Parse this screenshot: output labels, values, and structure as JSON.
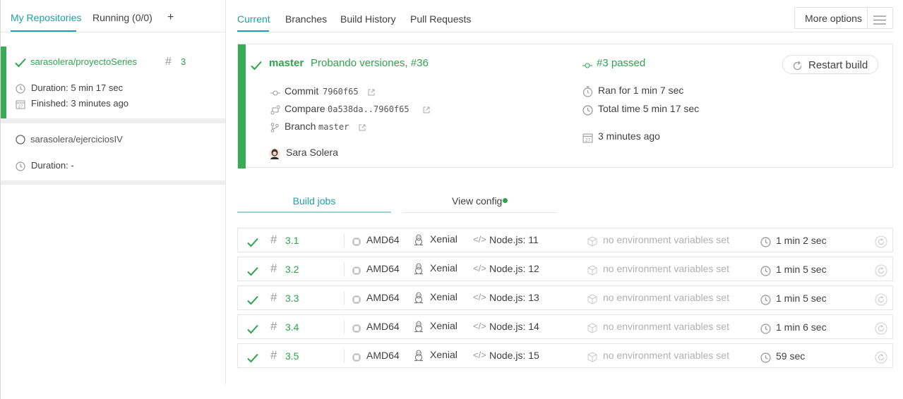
{
  "sidebar": {
    "tabs": {
      "my_repositories": "My Repositories",
      "running": "Running (0/0)",
      "add": "+"
    },
    "repos": [
      {
        "name": "sarasolera/proyectoSeries",
        "build_number": "3",
        "duration": "Duration: 5 min 17 sec",
        "finished": "Finished: 3 minutes ago",
        "status": "passed"
      },
      {
        "name": "sarasolera/ejerciciosIV",
        "duration": "Duration: -",
        "status": "none"
      }
    ]
  },
  "main_tabs": {
    "current": "Current",
    "branches": "Branches",
    "build_history": "Build History",
    "pull_requests": "Pull Requests"
  },
  "more_options": "More options",
  "build": {
    "branch": "master",
    "message": "Probando versiones, #36",
    "commit_label": "Commit",
    "commit": "7960f65",
    "compare_label": "Compare",
    "compare": "0a538da..7960f65",
    "branch_label": "Branch",
    "branch_value": "master",
    "author": "Sara Solera",
    "status": "#3 passed",
    "ran_for": "Ran for 1 min 7 sec",
    "total_time": "Total time 5 min 17 sec",
    "finished": "3 minutes ago",
    "restart_label": "Restart build",
    "calendar_day": "27"
  },
  "job_tabs": {
    "build_jobs": "Build jobs",
    "view_config": "View config"
  },
  "jobs": [
    {
      "number": "3.1",
      "arch": "AMD64",
      "os": "Xenial",
      "lang": "Node.js: 11",
      "env": "no environment variables set",
      "duration": "1 min 2 sec"
    },
    {
      "number": "3.2",
      "arch": "AMD64",
      "os": "Xenial",
      "lang": "Node.js: 12",
      "env": "no environment variables set",
      "duration": "1 min 5 sec"
    },
    {
      "number": "3.3",
      "arch": "AMD64",
      "os": "Xenial",
      "lang": "Node.js: 13",
      "env": "no environment variables set",
      "duration": "1 min 5 sec"
    },
    {
      "number": "3.4",
      "arch": "AMD64",
      "os": "Xenial",
      "lang": "Node.js: 14",
      "env": "no environment variables set",
      "duration": "1 min 6 sec"
    },
    {
      "number": "3.5",
      "arch": "AMD64",
      "os": "Xenial",
      "lang": "Node.js: 15",
      "env": "no environment variables set",
      "duration": "59 sec"
    }
  ],
  "colors": {
    "passed": "#39aa56",
    "accent": "#1ea1a6",
    "border": "#e6e6e6"
  }
}
